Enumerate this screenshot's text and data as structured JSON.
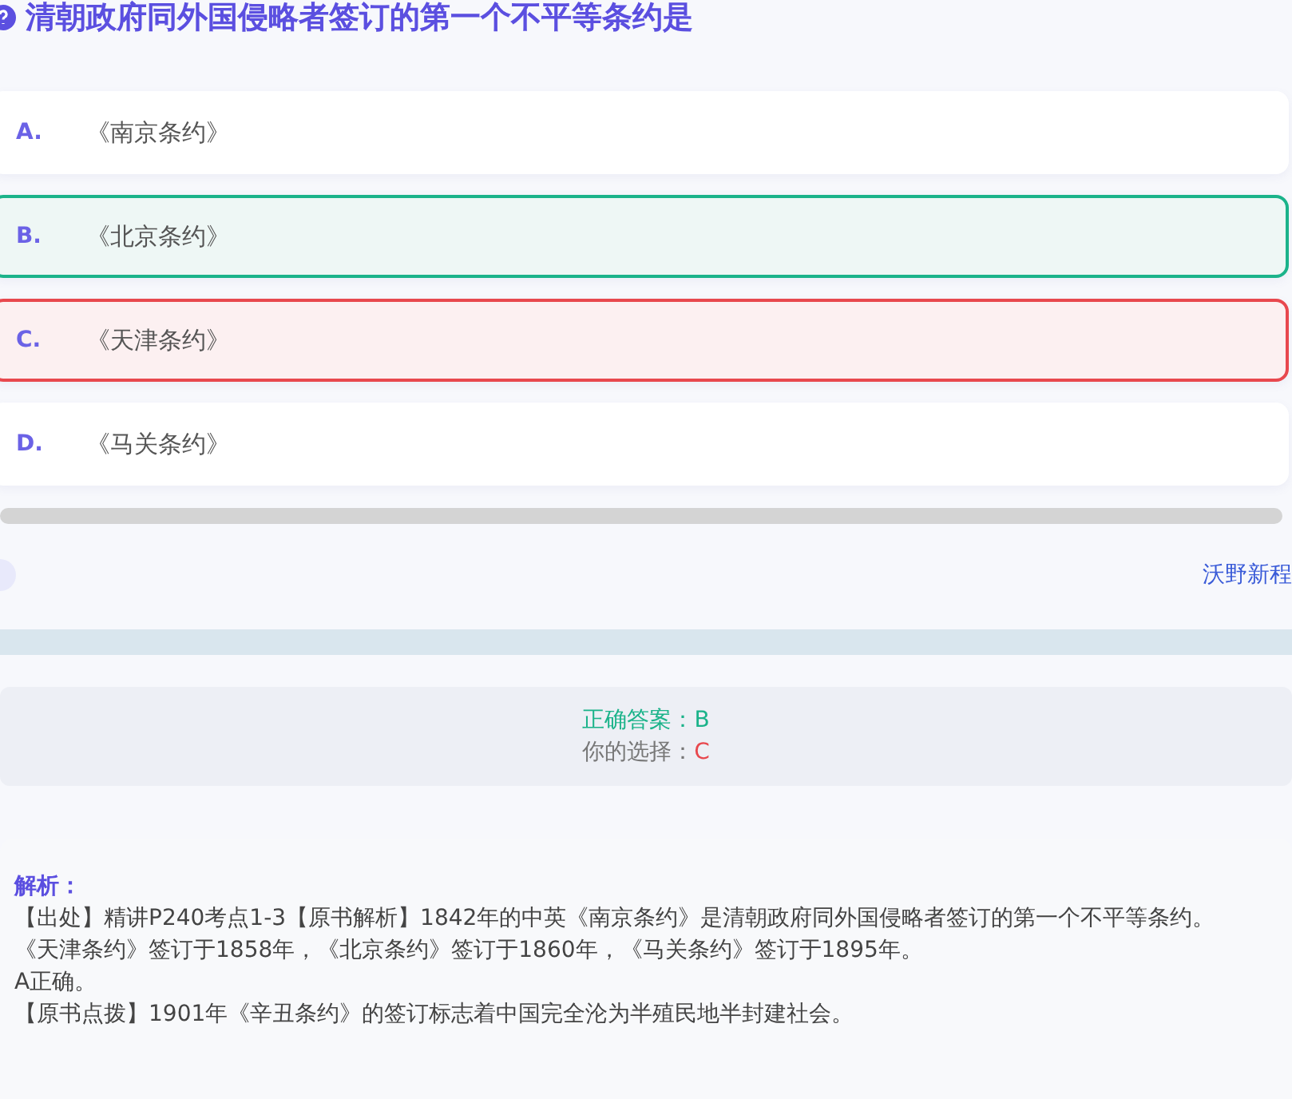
{
  "question": {
    "title": "清朝政府同外国侵略者签订的第一个不平等条约是"
  },
  "options": [
    {
      "letter": "A.",
      "text": "《南京条约》",
      "kind": "plain"
    },
    {
      "letter": "B.",
      "text": "《北京条约》",
      "kind": "correct"
    },
    {
      "letter": "C.",
      "text": "《天津条约》",
      "kind": "wrong"
    },
    {
      "letter": "D.",
      "text": "《马关条约》",
      "kind": "plain"
    }
  ],
  "footer": {
    "link": "沃野新程"
  },
  "result": {
    "correct_label": "正确答案：",
    "correct_value": "B",
    "choice_label": "你的选择：",
    "choice_value": "C"
  },
  "analysis": {
    "heading": "解析：",
    "lines": [
      "【出处】精讲P240考点1-3【原书解析】1842年的中英《南京条约》是清朝政府同外国侵略者签订的第一个不平等条约。",
      "《天津条约》签订于1858年，《北京条约》签订于1860年，《马关条约》签订于1895年。",
      "A正确。",
      "【原书点拨】1901年《辛丑条约》的签订标志着中国完全沦为半殖民地半封建社会。"
    ]
  }
}
